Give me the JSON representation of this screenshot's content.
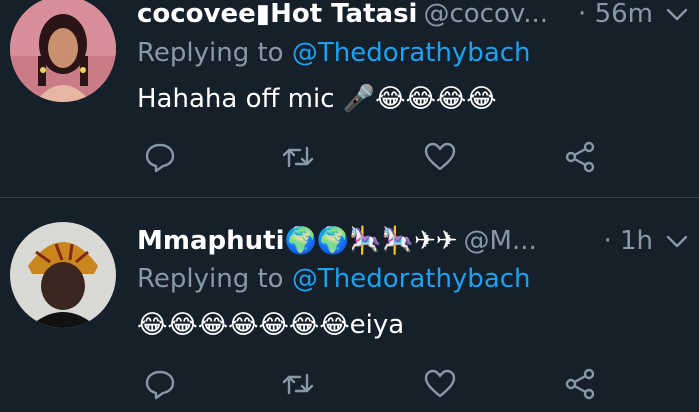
{
  "tweets": [
    {
      "name": "cocovee▮Hot Tatasi",
      "handle": "@cocov...",
      "time": "· 56m",
      "reply_prefix": "Replying to",
      "reply_to": "@Thedorathybach",
      "text": "Hahaha off mic 🎤😂😂😂😂"
    },
    {
      "name": "Mmaphuti🌍🌍🎠🎠✈✈",
      "handle": "@M...",
      "time": "· 1h",
      "reply_prefix": "Replying to",
      "reply_to": "@Thedorathybach",
      "text": "😂😂😂😂😂😂😂eiya"
    }
  ],
  "colors": {
    "background": "#15202b",
    "secondary_text": "#8899a6",
    "link": "#1da1f2",
    "divider": "#38444d"
  },
  "icons": [
    "reply-icon",
    "retweet-icon",
    "like-icon",
    "share-icon",
    "chevron-down-icon"
  ]
}
